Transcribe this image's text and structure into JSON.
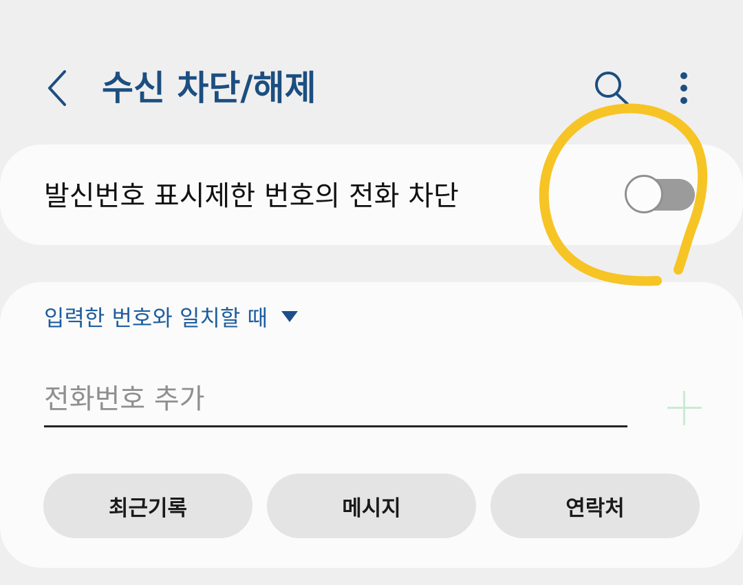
{
  "header": {
    "title": "수신 차단/해제",
    "back_icon": "chevron-left-icon",
    "search_icon": "search-icon",
    "more_icon": "more-vertical-icon"
  },
  "block_unknown": {
    "label": "발신번호 표시제한 번호의 전화 차단",
    "enabled": false
  },
  "match_rule": {
    "selected": "입력한 번호와 일치할 때",
    "icon": "caret-down-icon"
  },
  "phone_field": {
    "value": "",
    "placeholder": "전화번호 추가"
  },
  "add_icon": "plus-icon",
  "sources": [
    "최근기록",
    "메시지",
    "연락처"
  ],
  "colors": {
    "accent": "#1c4e80",
    "highlight": "#f7c425",
    "add": "#cbead3"
  }
}
